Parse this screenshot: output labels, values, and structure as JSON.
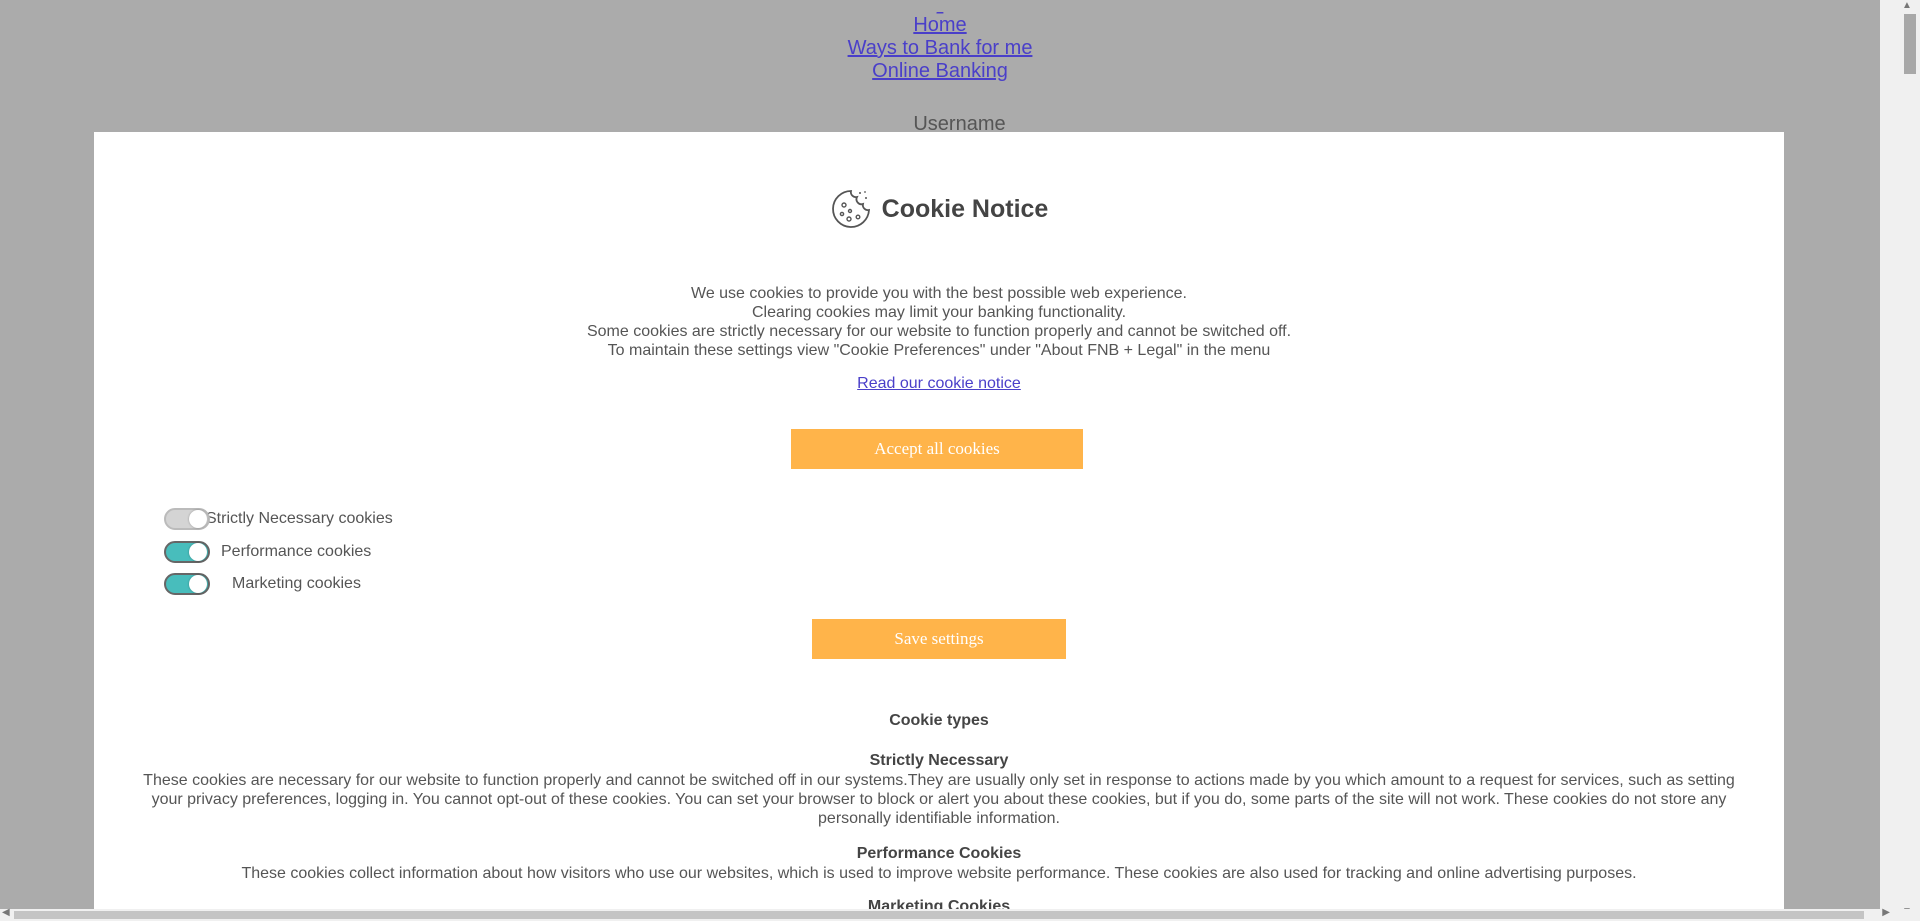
{
  "background": {
    "nav_tiny": "_",
    "nav": [
      "Home",
      "Ways to Bank for me",
      "Online Banking"
    ],
    "username_label": "Username"
  },
  "modal": {
    "title": "Cookie Notice",
    "intro_lines": [
      "We use cookies to provide you with the best possible web experience.",
      "Clearing cookies may limit your banking functionality.",
      "Some cookies are strictly necessary for our website to function properly and cannot be switched off.",
      "To maintain these settings view \"Cookie Preferences\" under \"About FNB + Legal\" in the menu"
    ],
    "read_link": "Read our cookie notice",
    "accept_button": "Accept all cookies",
    "toggles": [
      {
        "label": "Strictly Necessary cookies",
        "state": "on-disabled"
      },
      {
        "label": "Performance cookies",
        "state": "on"
      },
      {
        "label": "Marketing cookies",
        "state": "on"
      }
    ],
    "save_button": "Save settings",
    "types_heading": "Cookie types",
    "sections": [
      {
        "title": "Strictly Necessary",
        "text": "These cookies are necessary for our website to function properly and cannot be switched off in our systems.They are usually only set in response to actions made by you which amount to a request for services, such as setting your privacy preferences, logging in. You cannot opt-out of these cookies. You can set your browser to block or alert you about these cookies, but if you do, some parts of the site will not work. These cookies do not store any personally identifiable information."
      },
      {
        "title": "Performance Cookies",
        "text": "These cookies collect information about how visitors who use our websites, which is used to improve website performance. These cookies are also used for tracking and online advertising purposes."
      },
      {
        "title": "Marketing Cookies",
        "text": ""
      }
    ]
  },
  "colors": {
    "overlay": "#ababab",
    "accent": "#ffb44a",
    "toggle_on": "#48bdbc",
    "link": "#4a3fc9"
  }
}
